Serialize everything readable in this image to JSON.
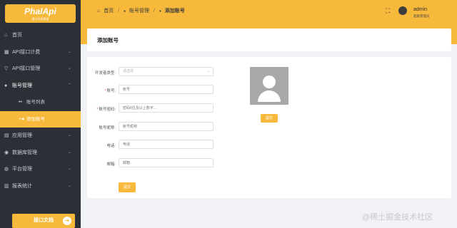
{
  "app": {
    "logo": "PhalApi",
    "logo_sub": "接口开发框架"
  },
  "sidebar": {
    "items": [
      {
        "label": "首页",
        "icon": "home-icon",
        "glyph": "⌂",
        "arrow": ""
      },
      {
        "label": "API接口计费",
        "icon": "cart-icon",
        "glyph": "▦",
        "arrow": "⌄"
      },
      {
        "label": "API接口管理",
        "icon": "funnel-icon",
        "glyph": "▽",
        "arrow": "⌄"
      },
      {
        "label": "账号管理",
        "icon": "user-icon",
        "glyph": "●",
        "arrow": "⌃"
      },
      {
        "label": "账号列表",
        "icon": "users-icon",
        "glyph": "••",
        "arrow": ""
      },
      {
        "label": "添加账号",
        "icon": "user-plus-icon",
        "glyph": "+●",
        "arrow": ""
      },
      {
        "label": "应用管理",
        "icon": "grid-icon",
        "glyph": "▤",
        "arrow": "⌄"
      },
      {
        "label": "数据库管理",
        "icon": "database-icon",
        "glyph": "◉",
        "arrow": "⌄"
      },
      {
        "label": "平台管理",
        "icon": "globe-icon",
        "glyph": "◍",
        "arrow": "⌄"
      },
      {
        "label": "报表统计",
        "icon": "chart-icon",
        "glyph": "▥",
        "arrow": "⌄"
      }
    ],
    "doc_button": "接口文档",
    "doc_arrow": "➔"
  },
  "header": {
    "breadcrumb": [
      {
        "label": "首页",
        "glyph": "⌂"
      },
      {
        "label": "账号管理",
        "glyph": "●"
      },
      {
        "label": "添加账号",
        "glyph": "●"
      }
    ],
    "separator": "/",
    "fullscreen_glyph": "⛶",
    "user_name": "admin",
    "user_role": "超级管理员"
  },
  "page": {
    "title": "添加账号"
  },
  "form": {
    "fields": [
      {
        "label": "开发者类型:",
        "placeholder": "请选择",
        "required": false,
        "type": "select"
      },
      {
        "label": "账号:",
        "placeholder": "账号",
        "required": true,
        "type": "text"
      },
      {
        "label": "账号密码:",
        "placeholder": "密码6位及以上数字...",
        "required": true,
        "type": "password"
      },
      {
        "label": "账号昵称:",
        "placeholder": "账号昵称",
        "required": false,
        "type": "text"
      },
      {
        "label": "电话:",
        "placeholder": "电话",
        "required": false,
        "type": "text"
      },
      {
        "label": "邮箱:",
        "placeholder": "邮箱",
        "required": false,
        "type": "text"
      }
    ],
    "upload_button": "提交",
    "submit_button": "提交",
    "select_chevron": "⌄"
  },
  "watermark": "@稀土掘金技术社区",
  "colors": {
    "accent": "#f6b93b",
    "sidebar_bg": "#2b2f36",
    "page_bg": "#f0f2f5"
  }
}
